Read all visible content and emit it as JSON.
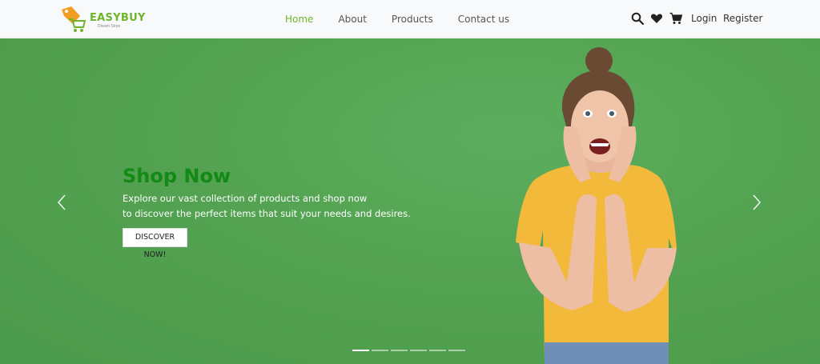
{
  "brand": {
    "name": "EASYBUY",
    "tagline": "Dream Store"
  },
  "nav": {
    "links": [
      {
        "label": "Home",
        "active": true
      },
      {
        "label": "About",
        "active": false
      },
      {
        "label": "Products",
        "active": false
      },
      {
        "label": "Contact us",
        "active": false
      }
    ],
    "icons": [
      "search-icon",
      "heart-icon",
      "cart-icon"
    ],
    "login_label": "Login",
    "register_label": "Register"
  },
  "hero": {
    "title": "Shop Now",
    "desc_line1": "Explore our vast collection of products and shop now",
    "desc_line2": "to discover the perfect items that suit your needs and desires.",
    "button_label": "DISCOVER NOW!",
    "slide_count": 6,
    "active_slide": 0
  },
  "colors": {
    "brand_green": "#6fb52c",
    "hero_bg": "#54a352",
    "title_green": "#138a16",
    "shirt_yellow": "#f2b93b"
  }
}
